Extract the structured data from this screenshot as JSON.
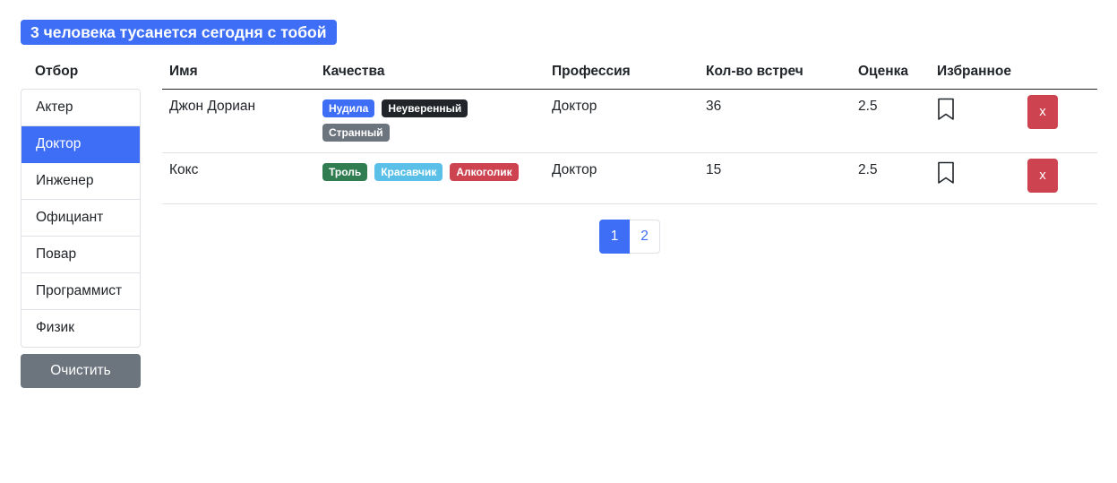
{
  "headline": {
    "text": "3 человека тусанется сегодня с тобой"
  },
  "filter": {
    "title": "Отбор",
    "items": [
      {
        "label": "Актер",
        "active": false
      },
      {
        "label": "Доктор",
        "active": true
      },
      {
        "label": "Инженер",
        "active": false
      },
      {
        "label": "Официант",
        "active": false
      },
      {
        "label": "Повар",
        "active": false
      },
      {
        "label": "Программист",
        "active": false
      },
      {
        "label": "Физик",
        "active": false
      }
    ],
    "clear_label": "Очистить"
  },
  "table": {
    "headers": [
      "Имя",
      "Качества",
      "Профессия",
      "Кол-во встреч",
      "Оценка",
      "Избранное",
      ""
    ],
    "rows": [
      {
        "name": "Джон Дориан",
        "qualities": [
          {
            "label": "Нудила",
            "color": "#3d6ef5"
          },
          {
            "label": "Неуверенный",
            "color": "#212529"
          },
          {
            "label": "Странный",
            "color": "#6c757d"
          }
        ],
        "profession": "Доктор",
        "meetings": "36",
        "rating": "2.5",
        "favorite_icon": "bookmark-icon",
        "delete_label": "x"
      },
      {
        "name": "Кокс",
        "qualities": [
          {
            "label": "Троль",
            "color": "#2f7d51"
          },
          {
            "label": "Красавчик",
            "color": "#5bc0e8"
          },
          {
            "label": "Алкоголик",
            "color": "#cd4350"
          }
        ],
        "profession": "Доктор",
        "meetings": "15",
        "rating": "2.5",
        "favorite_icon": "bookmark-icon",
        "delete_label": "x"
      }
    ]
  },
  "pagination": {
    "pages": [
      "1",
      "2"
    ],
    "current": "1"
  },
  "colors": {
    "primary": "#3d6ef5",
    "danger": "#cd4350",
    "secondary": "#6c757d",
    "link": "#3d6ef5"
  }
}
